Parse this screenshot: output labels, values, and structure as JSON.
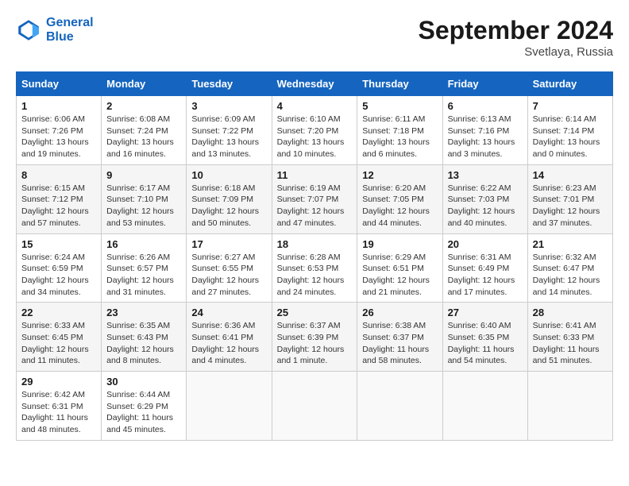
{
  "header": {
    "logo_line1": "General",
    "logo_line2": "Blue",
    "month_title": "September 2024",
    "location": "Svetlaya, Russia"
  },
  "days_of_week": [
    "Sunday",
    "Monday",
    "Tuesday",
    "Wednesday",
    "Thursday",
    "Friday",
    "Saturday"
  ],
  "weeks": [
    [
      {
        "day": "1",
        "sunrise": "6:06 AM",
        "sunset": "7:26 PM",
        "daylight": "13 hours and 19 minutes."
      },
      {
        "day": "2",
        "sunrise": "6:08 AM",
        "sunset": "7:24 PM",
        "daylight": "13 hours and 16 minutes."
      },
      {
        "day": "3",
        "sunrise": "6:09 AM",
        "sunset": "7:22 PM",
        "daylight": "13 hours and 13 minutes."
      },
      {
        "day": "4",
        "sunrise": "6:10 AM",
        "sunset": "7:20 PM",
        "daylight": "13 hours and 10 minutes."
      },
      {
        "day": "5",
        "sunrise": "6:11 AM",
        "sunset": "7:18 PM",
        "daylight": "13 hours and 6 minutes."
      },
      {
        "day": "6",
        "sunrise": "6:13 AM",
        "sunset": "7:16 PM",
        "daylight": "13 hours and 3 minutes."
      },
      {
        "day": "7",
        "sunrise": "6:14 AM",
        "sunset": "7:14 PM",
        "daylight": "13 hours and 0 minutes."
      }
    ],
    [
      {
        "day": "8",
        "sunrise": "6:15 AM",
        "sunset": "7:12 PM",
        "daylight": "12 hours and 57 minutes."
      },
      {
        "day": "9",
        "sunrise": "6:17 AM",
        "sunset": "7:10 PM",
        "daylight": "12 hours and 53 minutes."
      },
      {
        "day": "10",
        "sunrise": "6:18 AM",
        "sunset": "7:09 PM",
        "daylight": "12 hours and 50 minutes."
      },
      {
        "day": "11",
        "sunrise": "6:19 AM",
        "sunset": "7:07 PM",
        "daylight": "12 hours and 47 minutes."
      },
      {
        "day": "12",
        "sunrise": "6:20 AM",
        "sunset": "7:05 PM",
        "daylight": "12 hours and 44 minutes."
      },
      {
        "day": "13",
        "sunrise": "6:22 AM",
        "sunset": "7:03 PM",
        "daylight": "12 hours and 40 minutes."
      },
      {
        "day": "14",
        "sunrise": "6:23 AM",
        "sunset": "7:01 PM",
        "daylight": "12 hours and 37 minutes."
      }
    ],
    [
      {
        "day": "15",
        "sunrise": "6:24 AM",
        "sunset": "6:59 PM",
        "daylight": "12 hours and 34 minutes."
      },
      {
        "day": "16",
        "sunrise": "6:26 AM",
        "sunset": "6:57 PM",
        "daylight": "12 hours and 31 minutes."
      },
      {
        "day": "17",
        "sunrise": "6:27 AM",
        "sunset": "6:55 PM",
        "daylight": "12 hours and 27 minutes."
      },
      {
        "day": "18",
        "sunrise": "6:28 AM",
        "sunset": "6:53 PM",
        "daylight": "12 hours and 24 minutes."
      },
      {
        "day": "19",
        "sunrise": "6:29 AM",
        "sunset": "6:51 PM",
        "daylight": "12 hours and 21 minutes."
      },
      {
        "day": "20",
        "sunrise": "6:31 AM",
        "sunset": "6:49 PM",
        "daylight": "12 hours and 17 minutes."
      },
      {
        "day": "21",
        "sunrise": "6:32 AM",
        "sunset": "6:47 PM",
        "daylight": "12 hours and 14 minutes."
      }
    ],
    [
      {
        "day": "22",
        "sunrise": "6:33 AM",
        "sunset": "6:45 PM",
        "daylight": "12 hours and 11 minutes."
      },
      {
        "day": "23",
        "sunrise": "6:35 AM",
        "sunset": "6:43 PM",
        "daylight": "12 hours and 8 minutes."
      },
      {
        "day": "24",
        "sunrise": "6:36 AM",
        "sunset": "6:41 PM",
        "daylight": "12 hours and 4 minutes."
      },
      {
        "day": "25",
        "sunrise": "6:37 AM",
        "sunset": "6:39 PM",
        "daylight": "12 hours and 1 minute."
      },
      {
        "day": "26",
        "sunrise": "6:38 AM",
        "sunset": "6:37 PM",
        "daylight": "11 hours and 58 minutes."
      },
      {
        "day": "27",
        "sunrise": "6:40 AM",
        "sunset": "6:35 PM",
        "daylight": "11 hours and 54 minutes."
      },
      {
        "day": "28",
        "sunrise": "6:41 AM",
        "sunset": "6:33 PM",
        "daylight": "11 hours and 51 minutes."
      }
    ],
    [
      {
        "day": "29",
        "sunrise": "6:42 AM",
        "sunset": "6:31 PM",
        "daylight": "11 hours and 48 minutes."
      },
      {
        "day": "30",
        "sunrise": "6:44 AM",
        "sunset": "6:29 PM",
        "daylight": "11 hours and 45 minutes."
      },
      null,
      null,
      null,
      null,
      null
    ]
  ],
  "labels": {
    "sunrise_label": "Sunrise: ",
    "sunset_label": "Sunset: ",
    "daylight_label": "Daylight: "
  }
}
